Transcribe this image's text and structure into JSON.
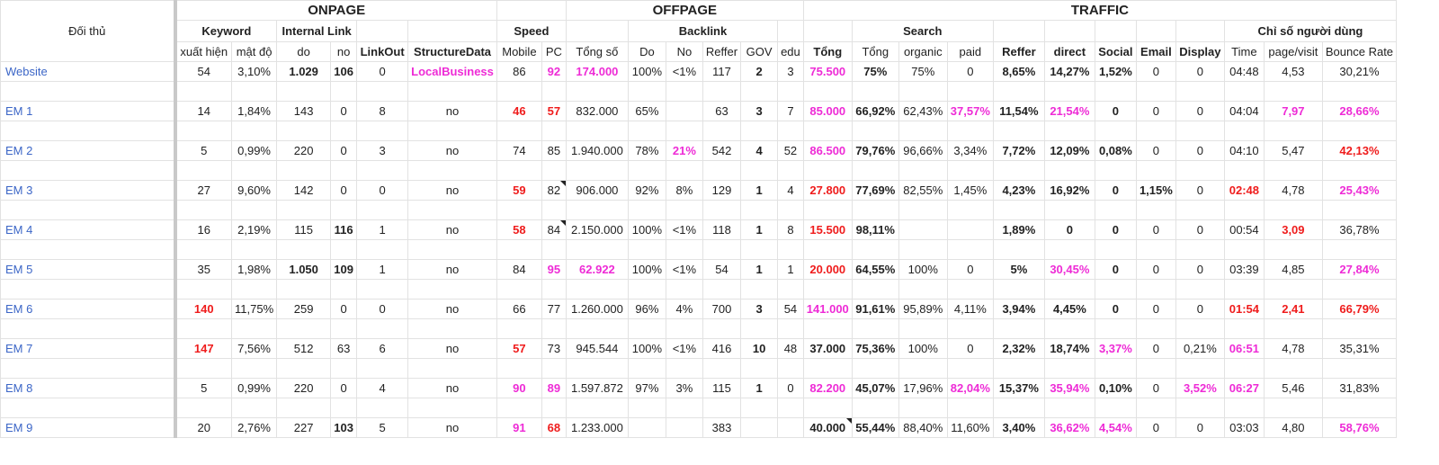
{
  "headers": {
    "doi_thu": "Đối thủ",
    "onpage": "ONPAGE",
    "offpage": "OFFPAGE",
    "traffic": "TRAFFIC",
    "keyword": "Keyword",
    "internal_link": "Internal Link",
    "speed": "Speed",
    "backlink": "Backlink",
    "search": "Search",
    "chi_so": "Chỉ số người dùng",
    "cols": [
      "xuất hiện",
      "mật độ",
      "do",
      "no",
      "LinkOut",
      "StructureData",
      "Mobile",
      "PC",
      "Tổng số",
      "Do",
      "No",
      "Reffer",
      "GOV",
      "edu",
      "Tổng",
      "Tổng",
      "organic",
      "paid",
      "Reffer",
      "direct",
      "Social",
      "Email",
      "Display",
      "Time",
      "page/visit",
      "Bounce Rate"
    ]
  },
  "colors": {
    "magenta": "#ee2bd6",
    "red": "#ef1c1c",
    "link": "#3c66c7"
  },
  "rows": [
    {
      "name": "Website",
      "cells": [
        [
          "54",
          ""
        ],
        [
          "3,10%",
          ""
        ],
        [
          "1.029",
          "b"
        ],
        [
          "106",
          "b"
        ],
        [
          "0",
          ""
        ],
        [
          "LocalBusiness",
          "m"
        ],
        [
          "86",
          ""
        ],
        [
          "92",
          "m"
        ],
        [
          "174.000",
          "m"
        ],
        [
          "100%",
          ""
        ],
        [
          "<1%",
          ""
        ],
        [
          "117",
          ""
        ],
        [
          "2",
          "b"
        ],
        [
          "3",
          ""
        ],
        [
          "75.500",
          "m"
        ],
        [
          "75%",
          "b"
        ],
        [
          "75%",
          ""
        ],
        [
          "0",
          ""
        ],
        [
          "8,65%",
          "b"
        ],
        [
          "14,27%",
          "b"
        ],
        [
          "1,52%",
          "b"
        ],
        [
          "0",
          ""
        ],
        [
          "0",
          ""
        ],
        [
          "04:48",
          ""
        ],
        [
          "4,53",
          ""
        ],
        [
          "30,21%",
          ""
        ]
      ]
    },
    {
      "name": "EM 1",
      "cells": [
        [
          "14",
          ""
        ],
        [
          "1,84%",
          ""
        ],
        [
          "143",
          ""
        ],
        [
          "0",
          ""
        ],
        [
          "8",
          ""
        ],
        [
          "no",
          ""
        ],
        [
          "46",
          "r"
        ],
        [
          "57",
          "r"
        ],
        [
          "832.000",
          ""
        ],
        [
          "65%",
          ""
        ],
        [
          "",
          ""
        ],
        [
          "63",
          ""
        ],
        [
          "3",
          "b"
        ],
        [
          "7",
          ""
        ],
        [
          "85.000",
          "m"
        ],
        [
          "66,92%",
          "b"
        ],
        [
          "62,43%",
          ""
        ],
        [
          "37,57%",
          "m"
        ],
        [
          "11,54%",
          "b"
        ],
        [
          "21,54%",
          "m"
        ],
        [
          "0",
          "b"
        ],
        [
          "0",
          ""
        ],
        [
          "0",
          ""
        ],
        [
          "04:04",
          ""
        ],
        [
          "7,97",
          "m"
        ],
        [
          "28,66%",
          "m"
        ]
      ]
    },
    {
      "name": "EM 2",
      "cells": [
        [
          "5",
          ""
        ],
        [
          "0,99%",
          ""
        ],
        [
          "220",
          ""
        ],
        [
          "0",
          ""
        ],
        [
          "3",
          ""
        ],
        [
          "no",
          ""
        ],
        [
          "74",
          ""
        ],
        [
          "85",
          ""
        ],
        [
          "1.940.000",
          ""
        ],
        [
          "78%",
          ""
        ],
        [
          "21%",
          "m"
        ],
        [
          "542",
          ""
        ],
        [
          "4",
          "b"
        ],
        [
          "52",
          ""
        ],
        [
          "86.500",
          "m"
        ],
        [
          "79,76%",
          "b"
        ],
        [
          "96,66%",
          ""
        ],
        [
          "3,34%",
          ""
        ],
        [
          "7,72%",
          "b"
        ],
        [
          "12,09%",
          "b"
        ],
        [
          "0,08%",
          "b"
        ],
        [
          "0",
          ""
        ],
        [
          "0",
          ""
        ],
        [
          "04:10",
          ""
        ],
        [
          "5,47",
          ""
        ],
        [
          "42,13%",
          "r"
        ]
      ]
    },
    {
      "name": "EM 3",
      "cells": [
        [
          "27",
          ""
        ],
        [
          "9,60%",
          ""
        ],
        [
          "142",
          ""
        ],
        [
          "0",
          ""
        ],
        [
          "0",
          ""
        ],
        [
          "no",
          ""
        ],
        [
          "59",
          "r"
        ],
        [
          "82",
          "note"
        ],
        [
          "906.000",
          ""
        ],
        [
          "92%",
          ""
        ],
        [
          "8%",
          ""
        ],
        [
          "129",
          ""
        ],
        [
          "1",
          "b"
        ],
        [
          "4",
          ""
        ],
        [
          "27.800",
          "r"
        ],
        [
          "77,69%",
          "b"
        ],
        [
          "82,55%",
          ""
        ],
        [
          "1,45%",
          ""
        ],
        [
          "4,23%",
          "b"
        ],
        [
          "16,92%",
          "b"
        ],
        [
          "0",
          "b"
        ],
        [
          "1,15%",
          "b"
        ],
        [
          "0",
          ""
        ],
        [
          "02:48",
          "r"
        ],
        [
          "4,78",
          ""
        ],
        [
          "25,43%",
          "m"
        ]
      ]
    },
    {
      "name": "EM 4",
      "cells": [
        [
          "16",
          ""
        ],
        [
          "2,19%",
          ""
        ],
        [
          "115",
          ""
        ],
        [
          "116",
          "b"
        ],
        [
          "1",
          ""
        ],
        [
          "no",
          ""
        ],
        [
          "58",
          "r"
        ],
        [
          "84",
          "note"
        ],
        [
          "2.150.000",
          ""
        ],
        [
          "100%",
          ""
        ],
        [
          "<1%",
          ""
        ],
        [
          "118",
          ""
        ],
        [
          "1",
          "b"
        ],
        [
          "8",
          ""
        ],
        [
          "15.500",
          "r"
        ],
        [
          "98,11%",
          "b"
        ],
        [
          "",
          ""
        ],
        [
          "",
          ""
        ],
        [
          "1,89%",
          "b"
        ],
        [
          "0",
          "b"
        ],
        [
          "0",
          "b"
        ],
        [
          "0",
          ""
        ],
        [
          "0",
          ""
        ],
        [
          "00:54",
          ""
        ],
        [
          "3,09",
          "r"
        ],
        [
          "36,78%",
          ""
        ]
      ]
    },
    {
      "name": "EM 5",
      "cells": [
        [
          "35",
          ""
        ],
        [
          "1,98%",
          ""
        ],
        [
          "1.050",
          "b"
        ],
        [
          "109",
          "b"
        ],
        [
          "1",
          ""
        ],
        [
          "no",
          ""
        ],
        [
          "84",
          ""
        ],
        [
          "95",
          "m"
        ],
        [
          "62.922",
          "m"
        ],
        [
          "100%",
          ""
        ],
        [
          "<1%",
          ""
        ],
        [
          "54",
          ""
        ],
        [
          "1",
          "b"
        ],
        [
          "1",
          ""
        ],
        [
          "20.000",
          "r"
        ],
        [
          "64,55%",
          "b"
        ],
        [
          "100%",
          ""
        ],
        [
          "0",
          ""
        ],
        [
          "5%",
          "b"
        ],
        [
          "30,45%",
          "m"
        ],
        [
          "0",
          "b"
        ],
        [
          "0",
          ""
        ],
        [
          "0",
          ""
        ],
        [
          "03:39",
          ""
        ],
        [
          "4,85",
          ""
        ],
        [
          "27,84%",
          "m"
        ]
      ]
    },
    {
      "name": "EM 6",
      "cells": [
        [
          "140",
          "r"
        ],
        [
          "11,75%",
          ""
        ],
        [
          "259",
          ""
        ],
        [
          "0",
          ""
        ],
        [
          "0",
          ""
        ],
        [
          "no",
          ""
        ],
        [
          "66",
          ""
        ],
        [
          "77",
          ""
        ],
        [
          "1.260.000",
          ""
        ],
        [
          "96%",
          ""
        ],
        [
          "4%",
          ""
        ],
        [
          "700",
          ""
        ],
        [
          "3",
          "b"
        ],
        [
          "54",
          ""
        ],
        [
          "141.000",
          "m"
        ],
        [
          "91,61%",
          "b"
        ],
        [
          "95,89%",
          ""
        ],
        [
          "4,11%",
          ""
        ],
        [
          "3,94%",
          "b"
        ],
        [
          "4,45%",
          "b"
        ],
        [
          "0",
          "b"
        ],
        [
          "0",
          ""
        ],
        [
          "0",
          ""
        ],
        [
          "01:54",
          "r"
        ],
        [
          "2,41",
          "r"
        ],
        [
          "66,79%",
          "r"
        ]
      ]
    },
    {
      "name": "EM 7",
      "cells": [
        [
          "147",
          "r"
        ],
        [
          "7,56%",
          ""
        ],
        [
          "512",
          ""
        ],
        [
          "63",
          ""
        ],
        [
          "6",
          ""
        ],
        [
          "no",
          ""
        ],
        [
          "57",
          "r"
        ],
        [
          "73",
          ""
        ],
        [
          "945.544",
          ""
        ],
        [
          "100%",
          ""
        ],
        [
          "<1%",
          ""
        ],
        [
          "416",
          ""
        ],
        [
          "10",
          "b"
        ],
        [
          "48",
          ""
        ],
        [
          "37.000",
          "b"
        ],
        [
          "75,36%",
          "b"
        ],
        [
          "100%",
          ""
        ],
        [
          "0",
          ""
        ],
        [
          "2,32%",
          "b"
        ],
        [
          "18,74%",
          "b"
        ],
        [
          "3,37%",
          "m"
        ],
        [
          "0",
          ""
        ],
        [
          "0,21%",
          ""
        ],
        [
          "06:51",
          "m"
        ],
        [
          "4,78",
          ""
        ],
        [
          "35,31%",
          ""
        ]
      ]
    },
    {
      "name": "EM 8",
      "cells": [
        [
          "5",
          ""
        ],
        [
          "0,99%",
          ""
        ],
        [
          "220",
          ""
        ],
        [
          "0",
          ""
        ],
        [
          "4",
          ""
        ],
        [
          "no",
          ""
        ],
        [
          "90",
          "m"
        ],
        [
          "89",
          "m"
        ],
        [
          "1.597.872",
          ""
        ],
        [
          "97%",
          ""
        ],
        [
          "3%",
          ""
        ],
        [
          "115",
          ""
        ],
        [
          "1",
          "b"
        ],
        [
          "0",
          ""
        ],
        [
          "82.200",
          "m"
        ],
        [
          "45,07%",
          "b"
        ],
        [
          "17,96%",
          ""
        ],
        [
          "82,04%",
          "m"
        ],
        [
          "15,37%",
          "b"
        ],
        [
          "35,94%",
          "m"
        ],
        [
          "0,10%",
          "b"
        ],
        [
          "0",
          ""
        ],
        [
          "3,52%",
          "m"
        ],
        [
          "06:27",
          "m"
        ],
        [
          "5,46",
          ""
        ],
        [
          "31,83%",
          ""
        ]
      ]
    },
    {
      "name": "EM 9",
      "cells": [
        [
          "20",
          ""
        ],
        [
          "2,76%",
          ""
        ],
        [
          "227",
          ""
        ],
        [
          "103",
          "b"
        ],
        [
          "5",
          ""
        ],
        [
          "no",
          ""
        ],
        [
          "91",
          "m"
        ],
        [
          "68",
          "r"
        ],
        [
          "1.233.000",
          ""
        ],
        [
          "",
          ""
        ],
        [
          "",
          ""
        ],
        [
          "383",
          ""
        ],
        [
          "",
          ""
        ],
        [
          "",
          ""
        ],
        [
          "40.000",
          "b note"
        ],
        [
          "55,44%",
          "b"
        ],
        [
          "88,40%",
          ""
        ],
        [
          "11,60%",
          ""
        ],
        [
          "3,40%",
          "b"
        ],
        [
          "36,62%",
          "m"
        ],
        [
          "4,54%",
          "m"
        ],
        [
          "0",
          ""
        ],
        [
          "0",
          ""
        ],
        [
          "03:03",
          ""
        ],
        [
          "4,80",
          ""
        ],
        [
          "58,76%",
          "m"
        ]
      ]
    }
  ]
}
